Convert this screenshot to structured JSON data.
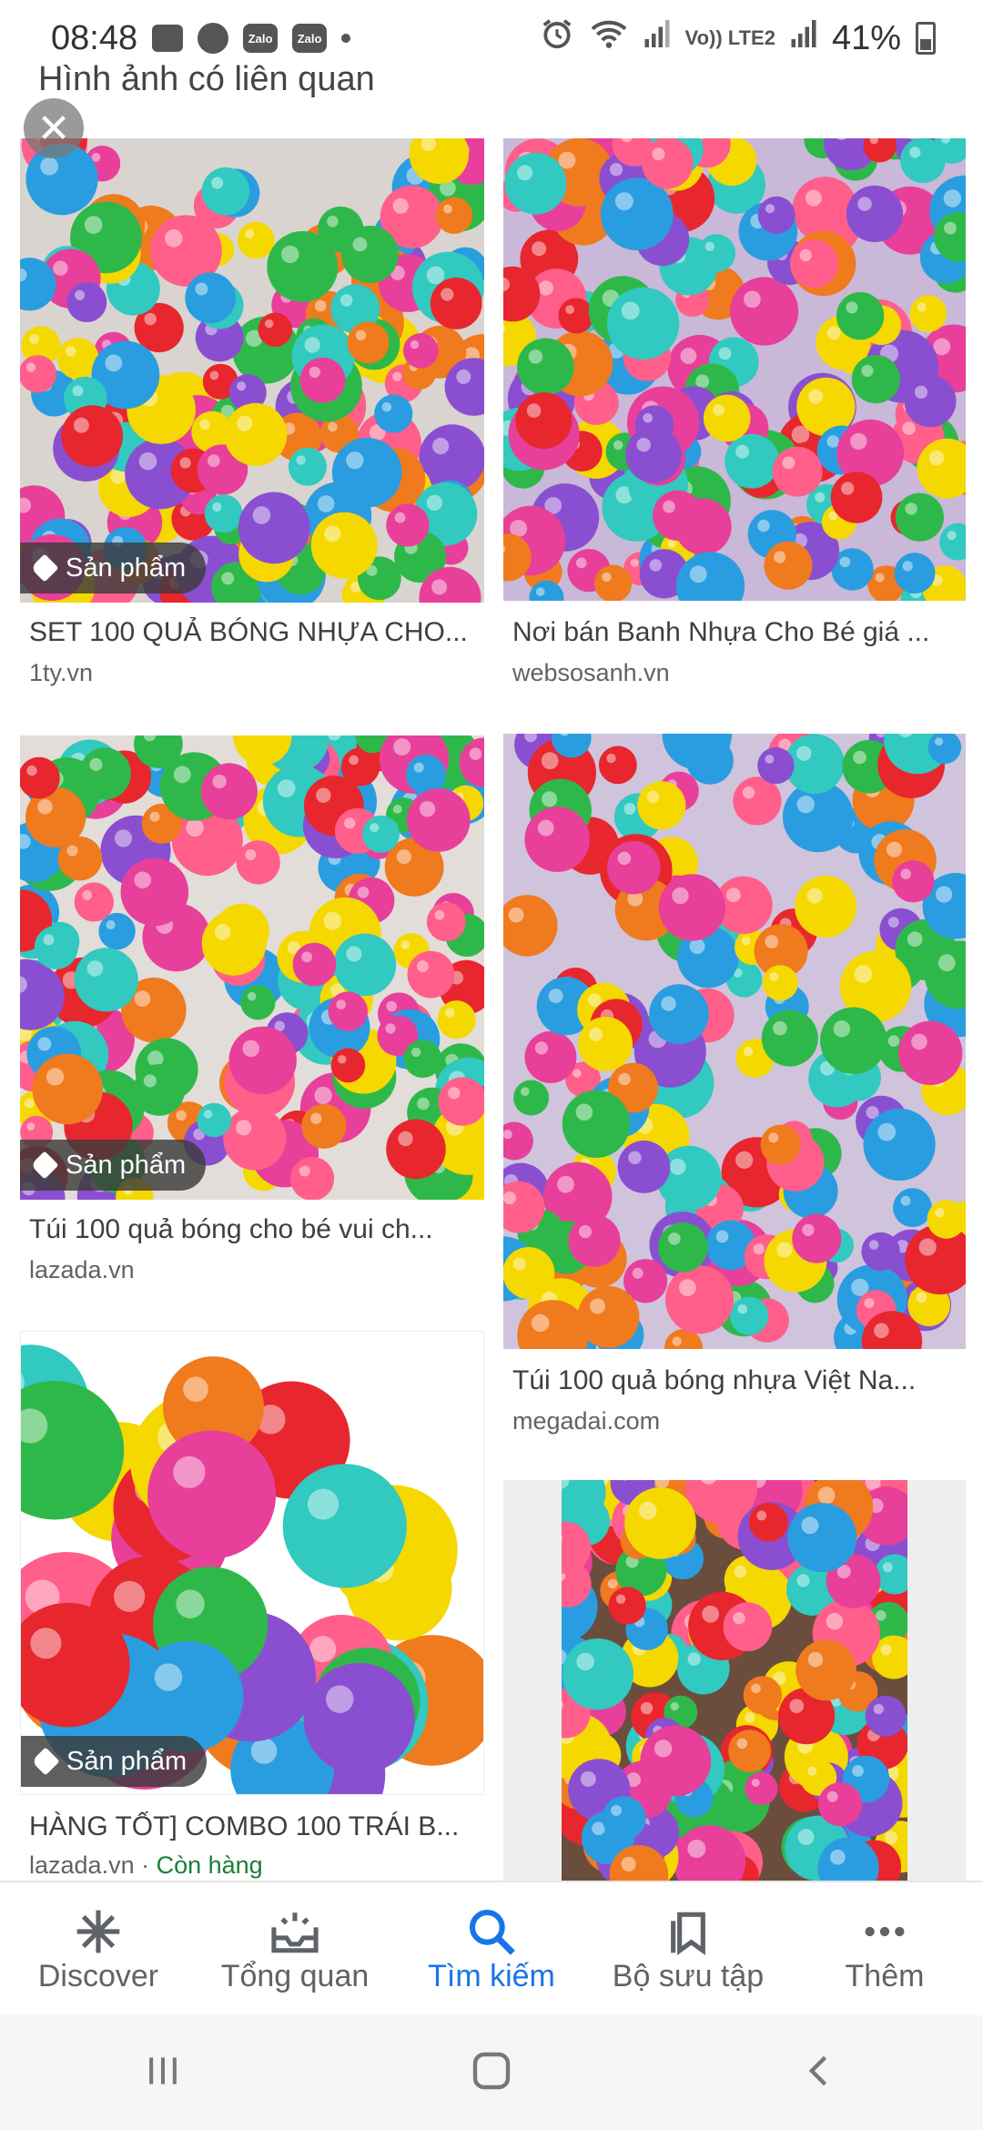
{
  "status_bar": {
    "time": "08:48",
    "notification_icons": [
      "message-icon",
      "messenger-icon",
      "zalo-icon",
      "zalo-icon"
    ],
    "zalo_label": "Zalo",
    "volte_label": "Vo)) LTE2",
    "battery": "41%"
  },
  "section_title": "Hình ảnh có liên quan",
  "results": [
    {
      "title": "SET 100 QUẢ BÓNG NHỰA CHO...",
      "source": "1ty.vn",
      "badge": "Sản phẩm"
    },
    {
      "title": "Nơi bán Banh Nhựa Cho Bé giá ...",
      "source": "websosanh.vn",
      "badge": ""
    },
    {
      "title": "Túi 100 quả bóng cho bé vui ch...",
      "source": "lazada.vn",
      "badge": "Sản phẩm"
    },
    {
      "title": "Túi 100 quả bóng nhựa Việt Na...",
      "source": "megadai.com",
      "badge": ""
    },
    {
      "title": "HÀNG TỐT] COMBO 100 TRÁI B...",
      "source": "lazada.vn",
      "source_sep": " · ",
      "stock": "Còn hàng",
      "badge": "Sản phẩm"
    }
  ],
  "bottom_nav": [
    {
      "label": "Discover",
      "icon": "asterisk-icon",
      "active": false
    },
    {
      "label": "Tổng quan",
      "icon": "inbox-icon",
      "active": false
    },
    {
      "label": "Tìm kiếm",
      "icon": "search-icon",
      "active": true
    },
    {
      "label": "Bộ sưu tập",
      "icon": "bookmark-icon",
      "active": false
    },
    {
      "label": "Thêm",
      "icon": "more-icon",
      "active": false
    }
  ],
  "colors": {
    "accent": "#1a73e8",
    "in_stock": "#188038"
  }
}
